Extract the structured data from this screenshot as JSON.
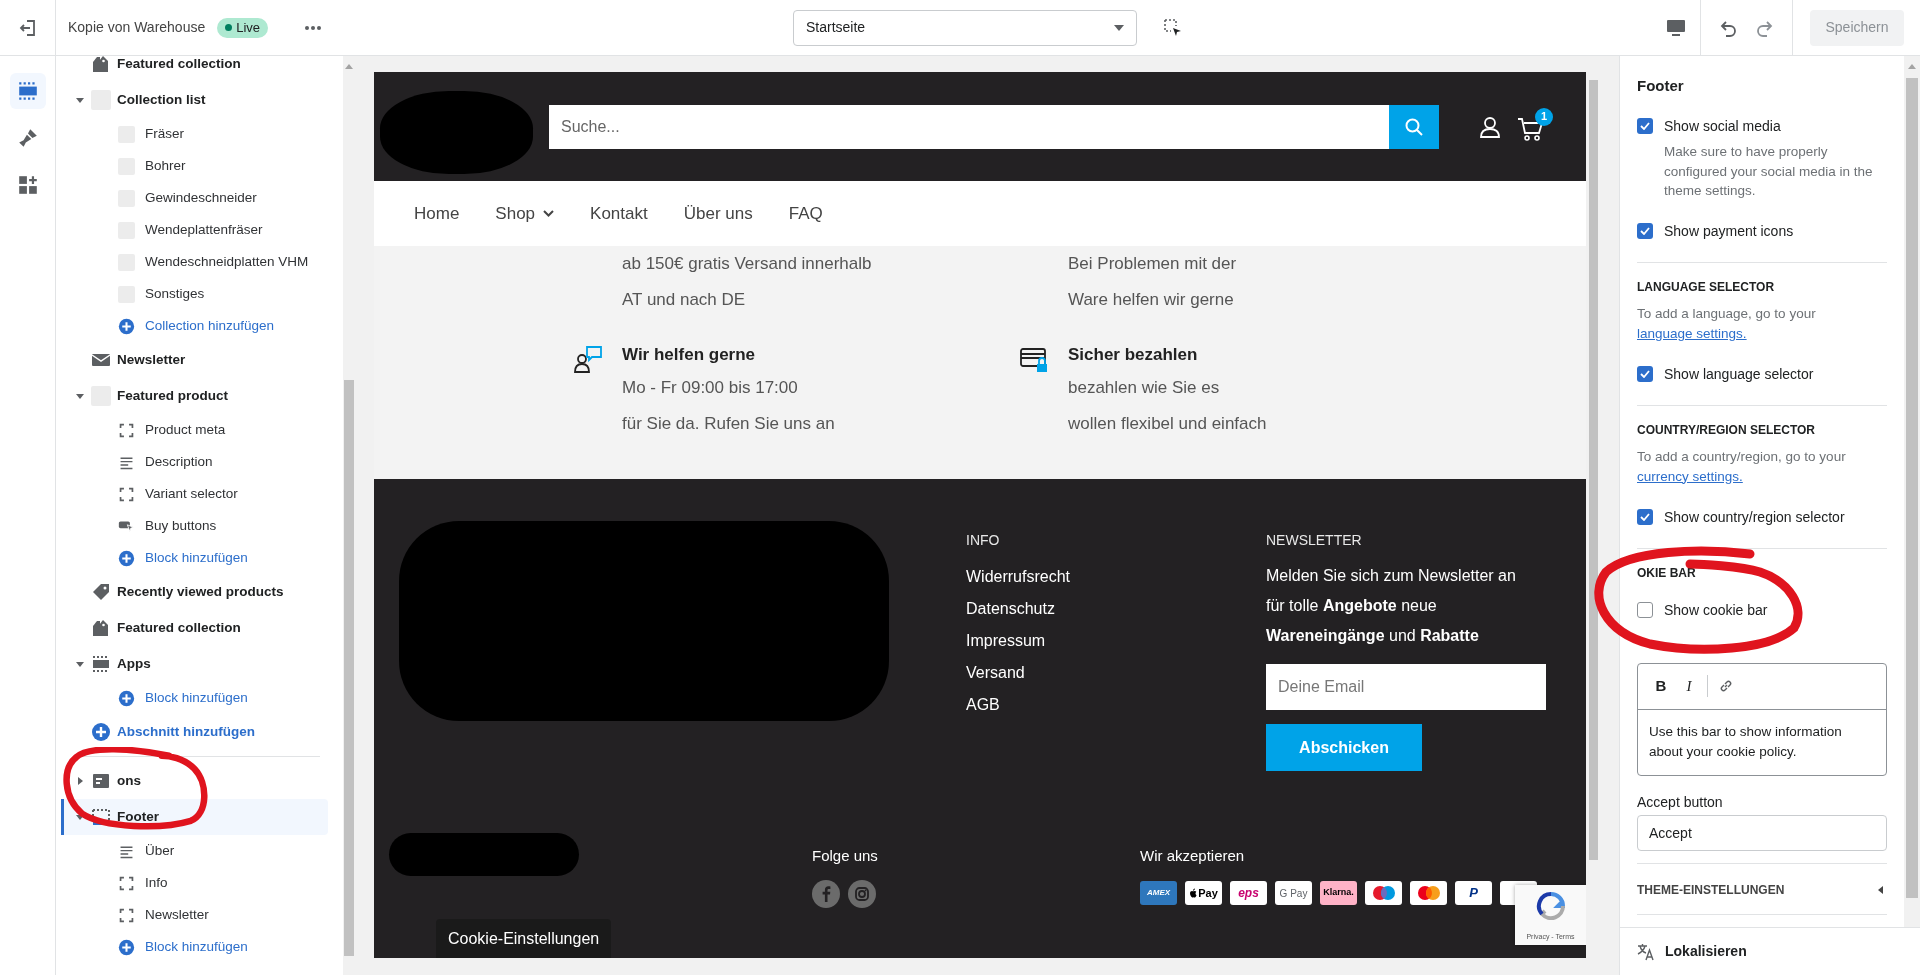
{
  "topbar": {
    "store_name": "Kopie von Warehouse",
    "status": "Live",
    "page_select": "Startseite",
    "save_button": "Speichern"
  },
  "rail": [
    {
      "kind": "sections",
      "selected": true
    },
    {
      "kind": "theme",
      "selected": false
    },
    {
      "kind": "apps",
      "selected": false
    }
  ],
  "sidebar": {
    "groups": [
      {
        "items": [
          {
            "label": "Featured collection",
            "kind": "collection",
            "selected": false
          },
          {
            "label": "Collection list",
            "kind": "thumbnail",
            "expanded": true,
            "selected": false,
            "children": [
              {
                "label": "Fräser",
                "kind": "thumbnail",
                "selected": false
              },
              {
                "label": "Bohrer",
                "kind": "thumbnail",
                "selected": false
              },
              {
                "label": "Gewindeschneider",
                "kind": "thumbnail",
                "selected": false
              },
              {
                "label": "Wendeplattenfräser",
                "kind": "thumbnail",
                "selected": false
              },
              {
                "label": "Wendeschneidplatten VHM",
                "kind": "thumbnail",
                "selected": false
              },
              {
                "label": "Sonstiges",
                "kind": "thumbnail",
                "selected": false
              },
              {
                "label": "Collection hinzufügen",
                "kind": "add"
              }
            ]
          },
          {
            "label": "Newsletter",
            "kind": "mail",
            "selected": false
          },
          {
            "label": "Featured product",
            "kind": "thumbnail",
            "expanded": true,
            "selected": false,
            "children": [
              {
                "label": "Product meta",
                "kind": "block",
                "selected": false
              },
              {
                "label": "Description",
                "kind": "lines",
                "selected": false
              },
              {
                "label": "Variant selector",
                "kind": "block",
                "selected": false
              },
              {
                "label": "Buy buttons",
                "kind": "cursor",
                "selected": false
              },
              {
                "label": "Block hinzufügen",
                "kind": "add"
              }
            ]
          },
          {
            "label": "Recently viewed products",
            "kind": "tag",
            "selected": false
          },
          {
            "label": "Featured collection",
            "kind": "collection",
            "selected": false
          },
          {
            "label": "Apps",
            "kind": "apps",
            "expanded": true,
            "selected": false,
            "children": [
              {
                "label": "Block hinzufügen",
                "kind": "add"
              }
            ]
          },
          {
            "label": "Abschnitt hinzufügen",
            "kind": "add"
          }
        ]
      },
      {
        "items": [
          {
            "label": "ons",
            "kind": "header",
            "expanded": false,
            "selected": false
          },
          {
            "label": "Footer",
            "kind": "footer",
            "expanded": true,
            "selected": true,
            "children": [
              {
                "label": "Über",
                "kind": "lines",
                "selected": false
              },
              {
                "label": "Info",
                "kind": "block",
                "selected": false
              },
              {
                "label": "Newsletter",
                "kind": "block",
                "selected": false
              },
              {
                "label": "Block hinzufügen",
                "kind": "add"
              }
            ]
          }
        ]
      }
    ]
  },
  "preview": {
    "header": {
      "search_placeholder": "Suche...",
      "cart_count": "1"
    },
    "nav": [
      {
        "label": "Home",
        "dropdown": false
      },
      {
        "label": "Shop",
        "dropdown": true
      },
      {
        "label": "Kontakt",
        "dropdown": false
      },
      {
        "label": "Über uns",
        "dropdown": false
      },
      {
        "label": "FAQ",
        "dropdown": false
      }
    ],
    "features": [
      {
        "kind": "partial",
        "lines": [
          "ab 150€ gratis Versand innerhalb",
          "AT und nach DE"
        ]
      },
      {
        "kind": "partial",
        "lines": [
          "Bei Problemen mit der",
          "Ware helfen wir gerne"
        ]
      },
      {
        "kind": "support",
        "title": "Wir helfen gerne",
        "lines": [
          "Mo - Fr 09:00 bis 17:00",
          "für Sie da. Rufen Sie uns an"
        ]
      },
      {
        "kind": "card",
        "title": "Sicher bezahlen",
        "lines": [
          "bezahlen wie Sie es",
          "wollen flexibel und einfach"
        ]
      }
    ],
    "footer": {
      "info_heading": "INFO",
      "info_links": [
        "Widerrufsrecht",
        "Datenschutz",
        "Impressum",
        "Versand",
        "AGB"
      ],
      "newsletter_heading": "NEWSLETTER",
      "newsletter_text": "Melden Sie sich zum Newsletter an für tolle **Angebote** neue **Wareneingänge** und **Rabatte**",
      "email_placeholder": "Deine Email",
      "submit_button": "Abschicken",
      "social_heading": "Folge uns",
      "social": [
        {
          "kind": "facebook"
        },
        {
          "kind": "instagram"
        }
      ],
      "payment_heading": "Wir akzeptieren",
      "payments": [
        {
          "kind": "amex",
          "label": "AMEX"
        },
        {
          "kind": "applepay",
          "label": "Pay"
        },
        {
          "kind": "eps",
          "label": "eps"
        },
        {
          "kind": "gpay",
          "label": "G Pay"
        },
        {
          "kind": "klarna",
          "label": "Klarna."
        },
        {
          "kind": "maestro"
        },
        {
          "kind": "mastercard"
        },
        {
          "kind": "paypal",
          "label": "P"
        },
        {
          "kind": "blank"
        }
      ],
      "cookie_button": "Cookie-Einstellungen",
      "recaptcha_links": "Privacy - Terms"
    }
  },
  "settings": {
    "title": "Footer",
    "items": [
      {
        "kind": "checkbox",
        "label": "Show social media",
        "checked": true,
        "help": "Make sure to have properly configured your social media in the theme settings."
      },
      {
        "kind": "checkbox",
        "label": "Show payment icons",
        "checked": true
      },
      {
        "kind": "divider"
      },
      {
        "kind": "heading",
        "text": "LANGUAGE SELECTOR"
      },
      {
        "kind": "help",
        "text": "To add a language, go to your",
        "link": "language settings."
      },
      {
        "kind": "checkbox",
        "label": "Show language selector",
        "checked": true
      },
      {
        "kind": "divider"
      },
      {
        "kind": "heading",
        "text": "COUNTRY/REGION SELECTOR"
      },
      {
        "kind": "help",
        "text": "To add a country/region, go to your",
        "link": "currency settings."
      },
      {
        "kind": "checkbox",
        "label": "Show country/region selector",
        "checked": true
      },
      {
        "kind": "divider"
      },
      {
        "kind": "heading",
        "text": "OKIE BAR"
      },
      {
        "kind": "checkbox",
        "label": "Show cookie bar",
        "checked": false
      },
      {
        "kind": "editor",
        "tools": [
          "B",
          "I"
        ],
        "text": "Use this bar to show information about your cookie policy."
      },
      {
        "kind": "field",
        "label": "Accept button",
        "value": "Accept"
      },
      {
        "kind": "divider"
      },
      {
        "kind": "collapsible",
        "label": "THEME-EINSTELLUNGEN",
        "expanded": false
      },
      {
        "kind": "divider"
      }
    ],
    "bottom_button": "Lokalisieren"
  }
}
